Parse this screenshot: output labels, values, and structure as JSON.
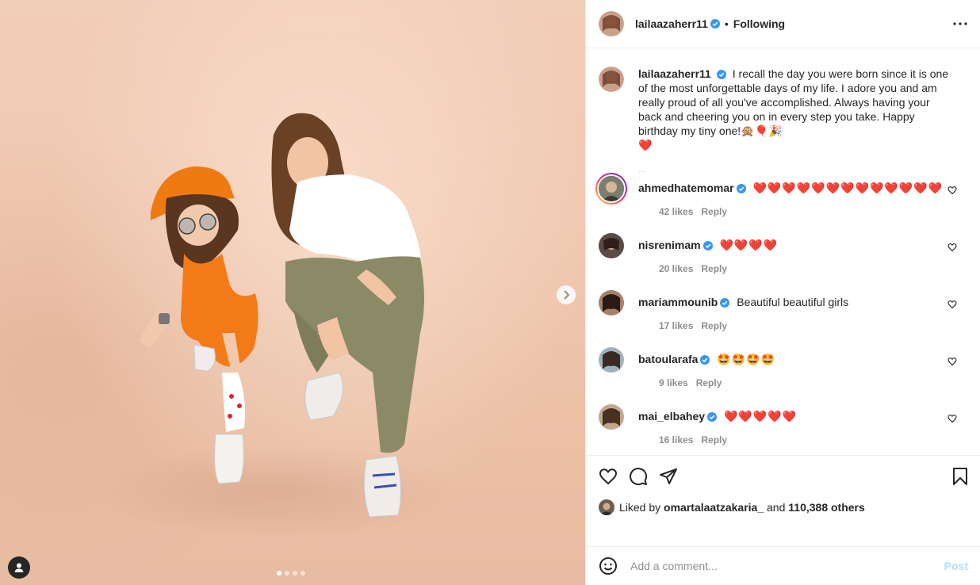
{
  "post": {
    "author": "lailaazaherr11",
    "follow_status": "Following",
    "more_icon": "more-horizontal-icon",
    "caption": "I recall the day you were born since it is one of the most unforgettable days of my life. I adore you and am really proud of all you've accomplished. Always having your back and cheering you on in every step you take. Happy birthday my tiny one!🙊🎈🎉",
    "caption_heart": "❤️",
    "caption_faint": "...",
    "carousel": {
      "total": 4,
      "active": 1
    }
  },
  "comments": [
    {
      "user": "ahmedhatemomar",
      "text": "❤️❤️❤️❤️❤️❤️❤️❤️❤️❤️❤️❤️❤️",
      "likes": "42 likes",
      "reply": "Reply"
    },
    {
      "user": "nisrenimam",
      "text": "❤️❤️❤️❤️",
      "likes": "20 likes",
      "reply": "Reply"
    },
    {
      "user": "mariammounib",
      "text": "Beautiful beautiful girls",
      "likes": "17 likes",
      "reply": "Reply"
    },
    {
      "user": "batoularafa",
      "text": "🤩🤩🤩🤩",
      "likes": "9 likes",
      "reply": "Reply"
    },
    {
      "user": "mai_elbahey",
      "text": "❤️❤️❤️❤️❤️",
      "likes": "16 likes",
      "reply": "Reply"
    }
  ],
  "likes": {
    "prefix": "Liked by",
    "user": "omartalaatzakaria_",
    "and": "and",
    "count": "110,388 others"
  },
  "add_comment": {
    "placeholder": "Add a comment...",
    "post_label": "Post"
  },
  "colors": {
    "verified": "#3897f0",
    "post_disabled": "#b2dffc",
    "heart": "#ed4956"
  }
}
